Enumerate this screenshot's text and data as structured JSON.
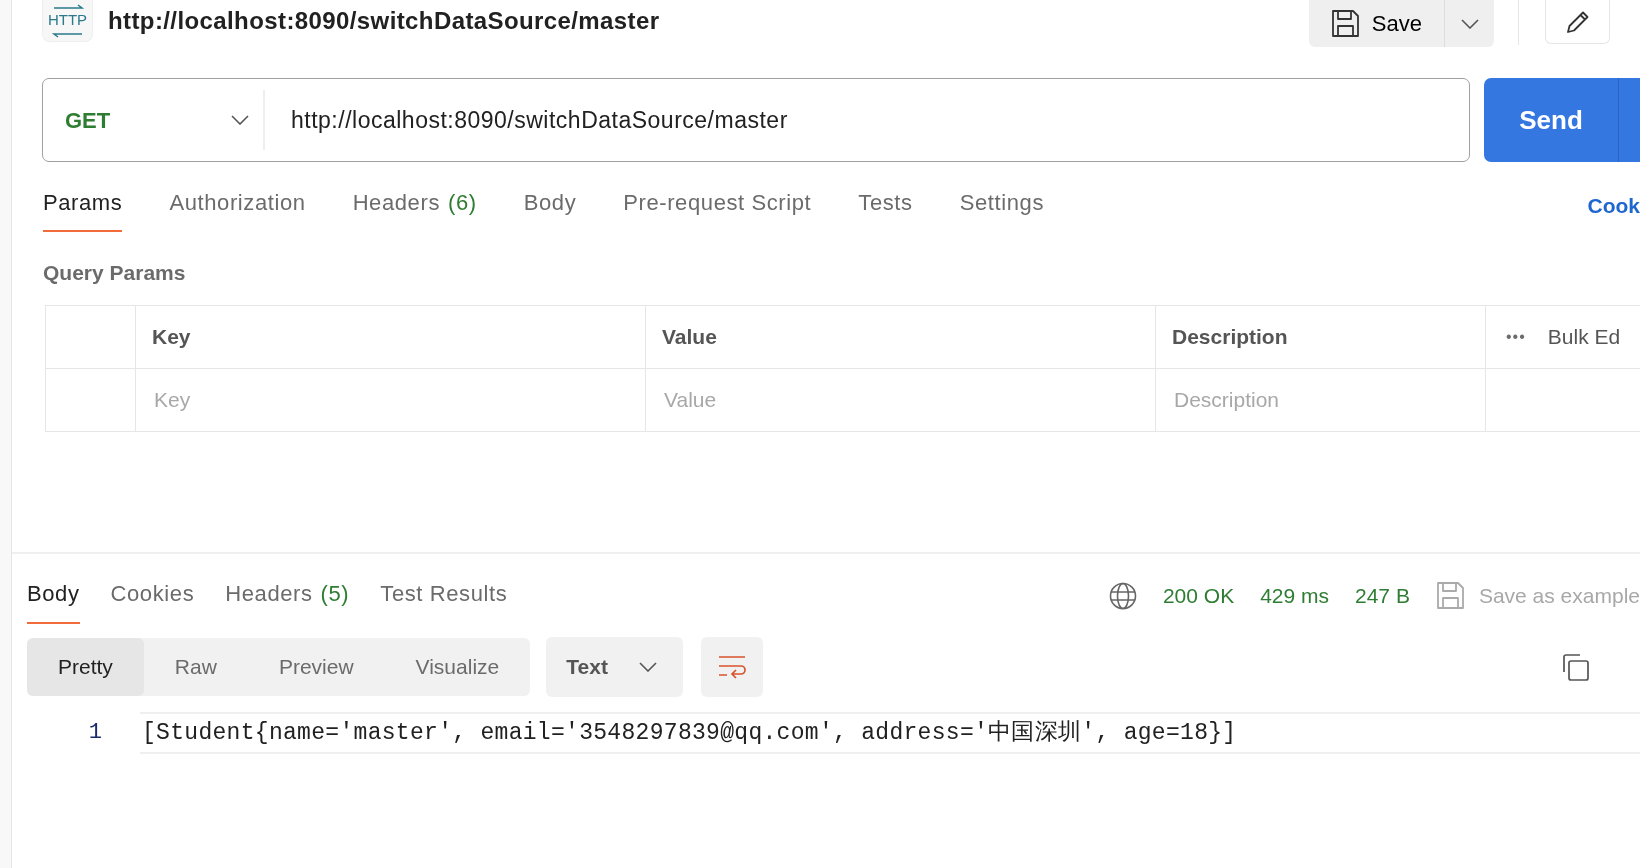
{
  "request": {
    "badge": "HTTP",
    "title": "http://localhost:8090/switchDataSource/master"
  },
  "save_button": "Save",
  "url_bar": {
    "method": "GET",
    "url": "http://localhost:8090/switchDataSource/master",
    "send_button": "Send"
  },
  "request_tabs": [
    {
      "label": "Params",
      "selected": true
    },
    {
      "label": "Authorization",
      "selected": false
    },
    {
      "label": "Headers",
      "count": "(6)",
      "selected": false
    },
    {
      "label": "Body",
      "selected": false
    },
    {
      "label": "Pre-request Script",
      "selected": false
    },
    {
      "label": "Tests",
      "selected": false
    },
    {
      "label": "Settings",
      "selected": false
    }
  ],
  "cookies_link": "Cook",
  "query_params": {
    "title": "Query Params",
    "columns": [
      "Key",
      "Value",
      "Description"
    ],
    "more": "•••",
    "bulk_edit": "Bulk Ed",
    "placeholders": [
      "Key",
      "Value",
      "Description"
    ]
  },
  "response_tabs": [
    {
      "label": "Body",
      "selected": true
    },
    {
      "label": "Cookies",
      "selected": false
    },
    {
      "label": "Headers",
      "count": "(5)",
      "selected": false
    },
    {
      "label": "Test Results",
      "selected": false
    }
  ],
  "status": {
    "code": "200 OK",
    "time": "429 ms",
    "size": "247 B"
  },
  "save_example": "Save as example",
  "view_modes": [
    {
      "label": "Pretty",
      "selected": true
    },
    {
      "label": "Raw",
      "selected": false
    },
    {
      "label": "Preview",
      "selected": false
    },
    {
      "label": "Visualize",
      "selected": false
    }
  ],
  "format": "Text",
  "lines": [
    {
      "number": "1",
      "text": "[Student{name='master', email='3548297839@qq.com', address='中国深圳', age=18}]"
    }
  ]
}
